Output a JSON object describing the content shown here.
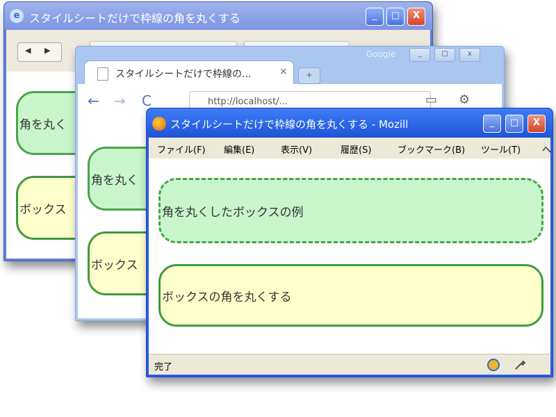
{
  "ie_window": {
    "title": "スタイルシートだけで枠線の角を丸くする",
    "back_label": "◀",
    "forward_label": "▶",
    "controls": {
      "minimize": "_",
      "maximize": "□",
      "close": "X"
    },
    "boxes": [
      "角を丸く",
      "ボックス"
    ]
  },
  "chrome_window": {
    "tab_title": "スタイルシートだけで枠線の...",
    "tab_close": "×",
    "new_tab": "+",
    "brand": "Google",
    "url": "http://localhost/...",
    "boxes": [
      "角を丸く",
      "ボックス"
    ]
  },
  "firefox_window": {
    "title": "スタイルシートだけで枠線の角を丸くする - Mozill",
    "menu": [
      "ファイル(F)",
      "編集(E)",
      "表示(V)",
      "履歴(S)",
      "ブックマーク(B)",
      "ツール(T)",
      "ヘ"
    ],
    "boxes": [
      "角を丸くしたボックスの例",
      "ボックスの角を丸くする"
    ],
    "status": "完了"
  },
  "colors": {
    "ie_titlebar": "#8ea4e8",
    "chrome_frame": "#a9c7f0",
    "firefox_titlebar": "#2a5de0",
    "box_green_fill": "#c9f5cc",
    "box_yellow_fill": "#ffffcc",
    "box_border": "#4aa44a"
  }
}
